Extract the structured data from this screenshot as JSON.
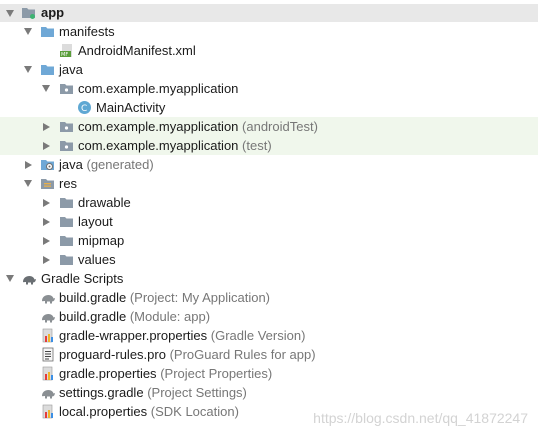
{
  "tree": {
    "app": "app",
    "manifests": "manifests",
    "android_manifest": "AndroidManifest.xml",
    "java": "java",
    "pkg_main": "com.example.myapplication",
    "main_activity": "MainActivity",
    "pkg_android_test": "com.example.myapplication",
    "pkg_android_test_suffix": "(androidTest)",
    "pkg_test": "com.example.myapplication",
    "pkg_test_suffix": "(test)",
    "java_generated": "java",
    "java_generated_suffix": "(generated)",
    "res": "res",
    "drawable": "drawable",
    "layout": "layout",
    "mipmap": "mipmap",
    "values": "values",
    "gradle_scripts": "Gradle Scripts",
    "gradle_files": [
      {
        "name": "build.gradle",
        "note": "(Project: My Application)"
      },
      {
        "name": "build.gradle",
        "note": "(Module: app)"
      },
      {
        "name": "gradle-wrapper.properties",
        "note": "(Gradle Version)"
      },
      {
        "name": "proguard-rules.pro",
        "note": "(ProGuard Rules for app)"
      },
      {
        "name": "gradle.properties",
        "note": "(Project Properties)"
      },
      {
        "name": "settings.gradle",
        "note": "(Project Settings)"
      },
      {
        "name": "local.properties",
        "note": "(SDK Location)"
      }
    ]
  },
  "icons": {
    "folder_color": "#6fa8d6",
    "package_color": "#8c9aa8",
    "class_color": "#5fa8d3",
    "highlight_bg": "#f0f7ec"
  },
  "watermark": "https://blog.csdn.net/qq_41872247"
}
